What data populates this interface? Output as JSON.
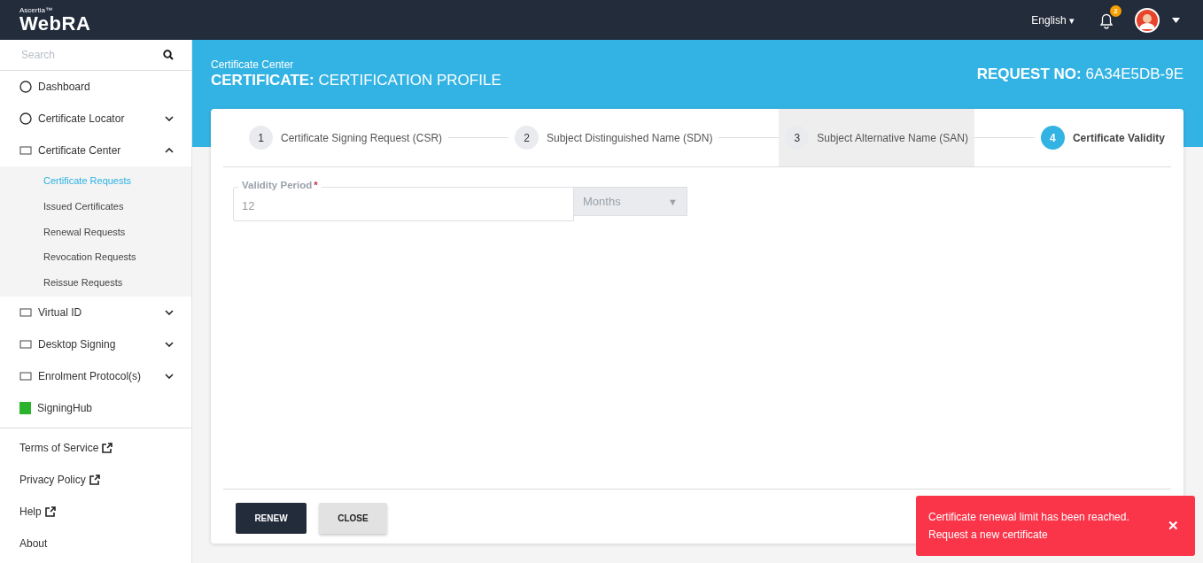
{
  "topbar": {
    "brand_small": "Ascertia™",
    "brand": "WebRA",
    "language": "English",
    "language_caret": "▾",
    "notification_count": "2"
  },
  "sidebar": {
    "search": {
      "placeholder": "Search"
    },
    "items": [
      {
        "label": "Dashboard"
      },
      {
        "label": "Certificate Locator",
        "expanded": false
      },
      {
        "label": "Certificate Center",
        "expanded": true,
        "children": [
          {
            "label": "Certificate Requests",
            "selected": true
          },
          {
            "label": "Issued Certificates",
            "selected": false
          },
          {
            "label": "Renewal Requests",
            "selected": false
          },
          {
            "label": "Revocation Requests",
            "selected": false
          },
          {
            "label": "Reissue Requests",
            "selected": false
          }
        ]
      },
      {
        "label": "Virtual ID",
        "expanded": false
      },
      {
        "label": "Desktop Signing",
        "expanded": false
      },
      {
        "label": "Enrolment Protocol(s)",
        "expanded": false
      },
      {
        "label": "SigningHub"
      }
    ],
    "footer_links": [
      {
        "label": "Terms of Service",
        "external": true
      },
      {
        "label": "Privacy Policy",
        "external": true
      },
      {
        "label": "Help",
        "external": true
      },
      {
        "label": "About",
        "external": false
      }
    ]
  },
  "header": {
    "breadcrumb": "Certificate Center",
    "title": "**CERTIFICATE:** CERTIFICATION PROFILE",
    "request_no": "**REQUEST NO:** 6A34E5DB-9E"
  },
  "steps": [
    {
      "number": "1",
      "label": "Certificate Signing Request (CSR)",
      "selected": false,
      "highlighted": false
    },
    {
      "number": "2",
      "label": "Subject Distinguished Name (SDN)",
      "selected": false,
      "highlighted": false
    },
    {
      "number": "3",
      "label": "Subject Alternative Name (SAN)",
      "selected": false,
      "highlighted": true
    },
    {
      "number": "4",
      "label": "Certificate Validity",
      "selected": true,
      "highlighted": false
    }
  ],
  "form": {
    "label": "Validity Period",
    "required_mark": "*",
    "value": "12",
    "unit": "Months",
    "unit_arrow": "▼"
  },
  "buttons": [
    {
      "label": "RENEW",
      "kind": "primary"
    },
    {
      "label": "CLOSE",
      "kind": "secondary"
    }
  ],
  "toast": {
    "message": "Certificate renewal limit has been reached. Request a new certificate",
    "close": "✕"
  }
}
